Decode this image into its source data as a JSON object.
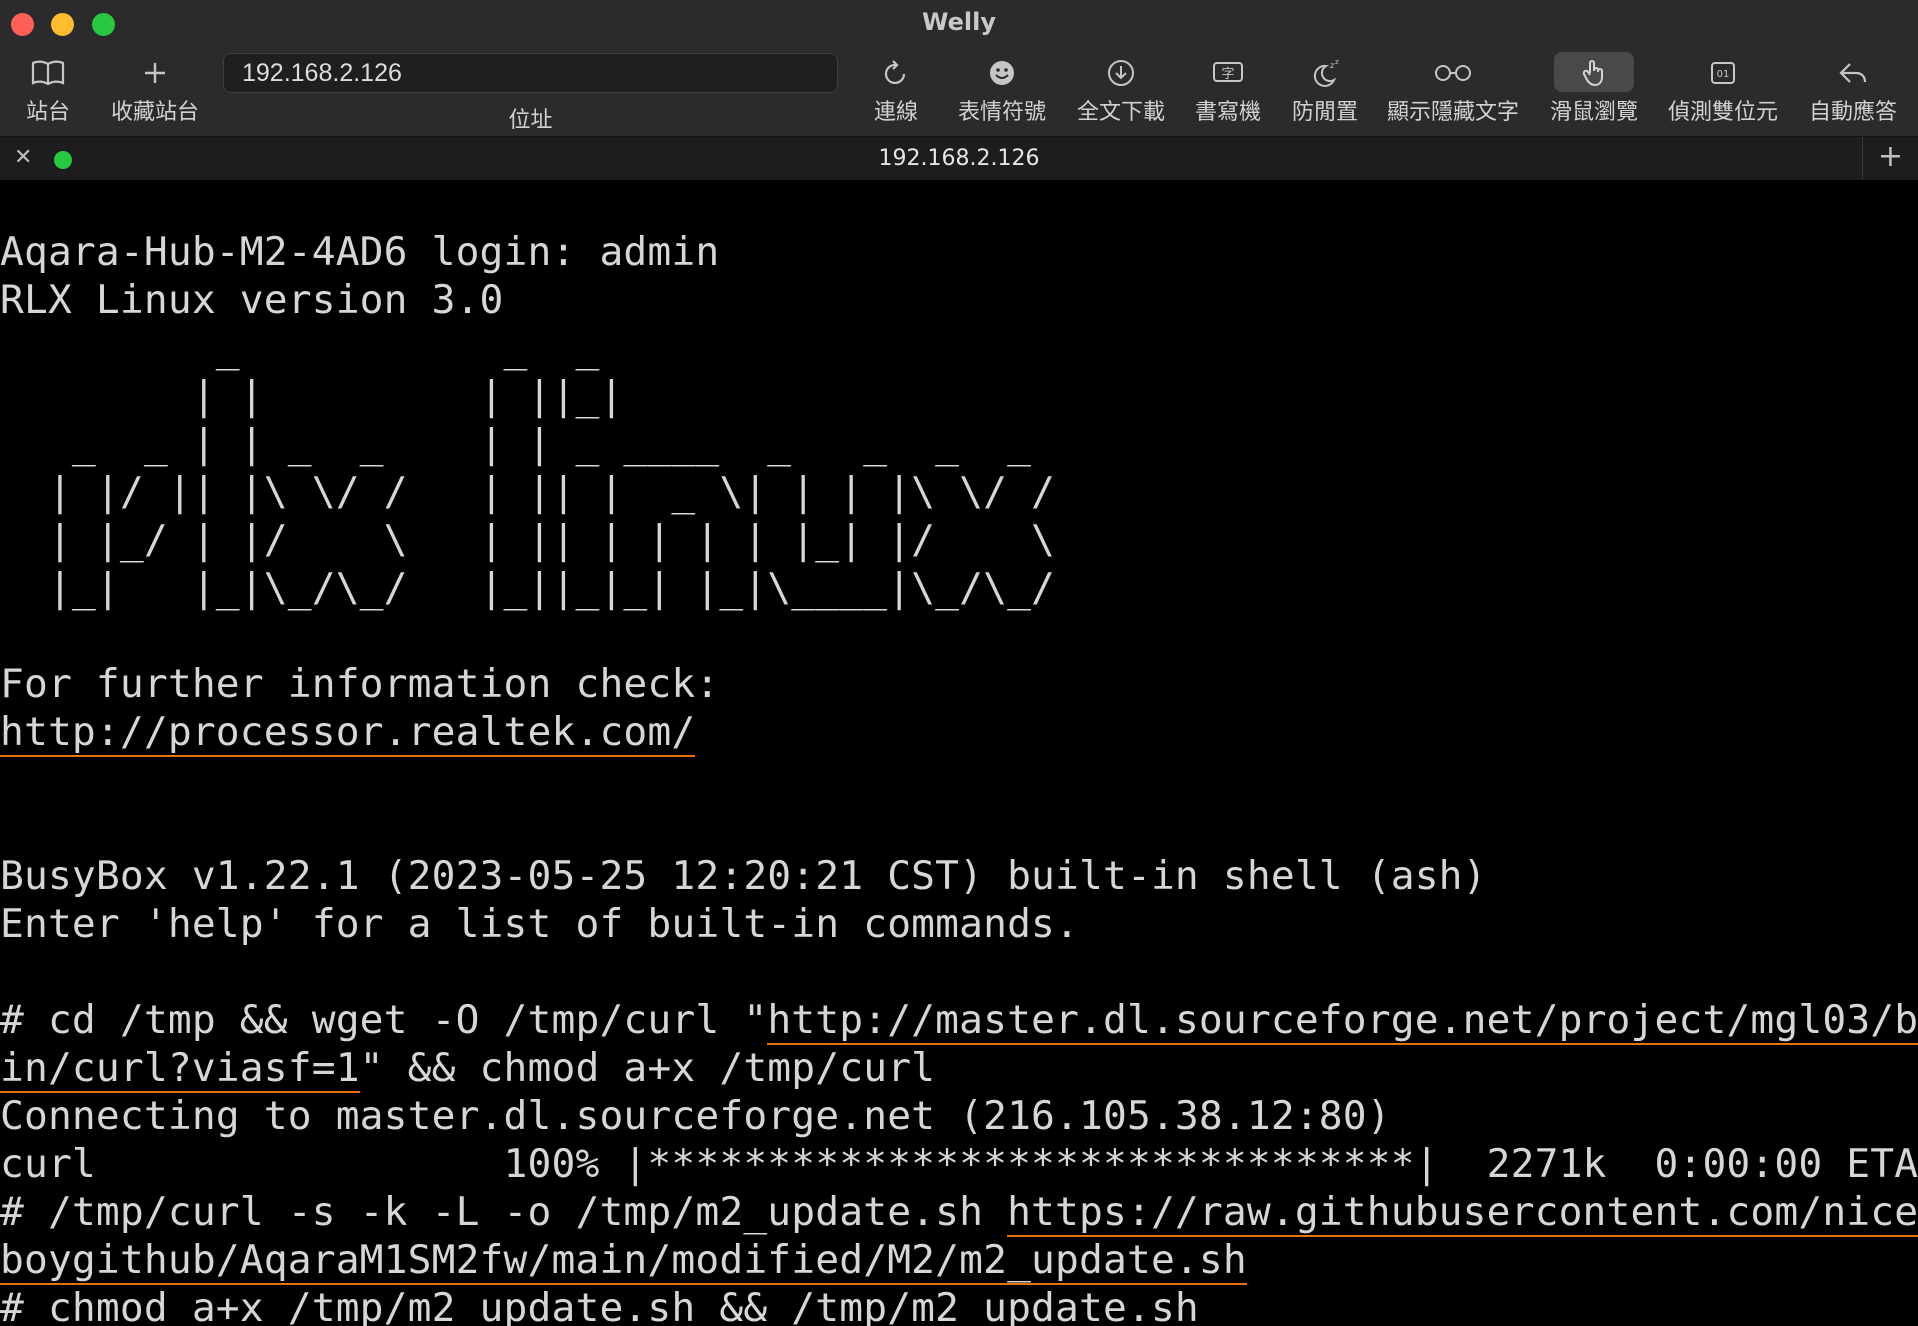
{
  "window": {
    "title": "Welly"
  },
  "toolbar": {
    "sites_label": "站台",
    "favorites_label": "收藏站台",
    "address_value": "192.168.2.126",
    "address_label": "位址",
    "buttons": {
      "connect": "連線",
      "emoji": "表情符號",
      "download": "全文下載",
      "composer": "書寫機",
      "anti_idle": "防閒置",
      "show_hidden": "顯示隱藏文字",
      "mouse_browse": "滑鼠瀏覽",
      "detect_dbcs": "偵測雙位元",
      "auto_reply": "自動應答"
    }
  },
  "tab": {
    "title": "192.168.2.126",
    "status_color": "#28c840"
  },
  "terminal": {
    "lines": {
      "l1": "Aqara-Hub-M2-4AD6 login: admin",
      "l2": "RLX Linux version 3.0",
      "a1": "         _           _  _",
      "a2": "        | |         | ||_|",
      "a3": "   _  _ | | _  _    | | _ ____  _   _  _  _",
      "a4": "  | |/ || |\\ \\/ /   | || |  _ \\| | | |\\ \\/ /",
      "a5": "  | |_/ | |/    \\   | || | | | | |_| |/    \\",
      "a6": "  |_|   |_|\\_/\\_/   |_||_|_| |_|\\____|\\_/\\_/",
      "l3": "For further information check:",
      "l4": "http://processor.realtek.com/",
      "l5": "BusyBox v1.22.1 (2023-05-25 12:20:21 CST) built-in shell (ash)",
      "l6": "Enter 'help' for a list of built-in commands.",
      "c1_a": "# cd /tmp && wget -O /tmp/curl \"",
      "c1_b": "http://master.dl.sourceforge.net/project/mgl03/b",
      "c2_a": "in/curl?viasf=1",
      "c2_b": "\" && chmod a+x /tmp/curl",
      "c3": "Connecting to master.dl.sourceforge.net (216.105.38.12:80)",
      "c4": "curl                 100% |********************************|  2271k  0:00:00 ETA",
      "c5_a": "# /tmp/curl -s -k -L -o /tmp/m2_update.sh ",
      "c5_b": "https://raw.githubusercontent.com/nice",
      "c6": "boygithub/AqaraM1SM2fw/main/modified/M2/m2_update.sh",
      "c7": "# chmod a+x /tmp/m2_update.sh && /tmp/m2_update.sh"
    }
  },
  "colors": {
    "toolbar_bg": "#2b2a2c",
    "terminal_bg": "#000000",
    "terminal_fg": "#d6d6d6",
    "link_underline": "#e8710f"
  }
}
